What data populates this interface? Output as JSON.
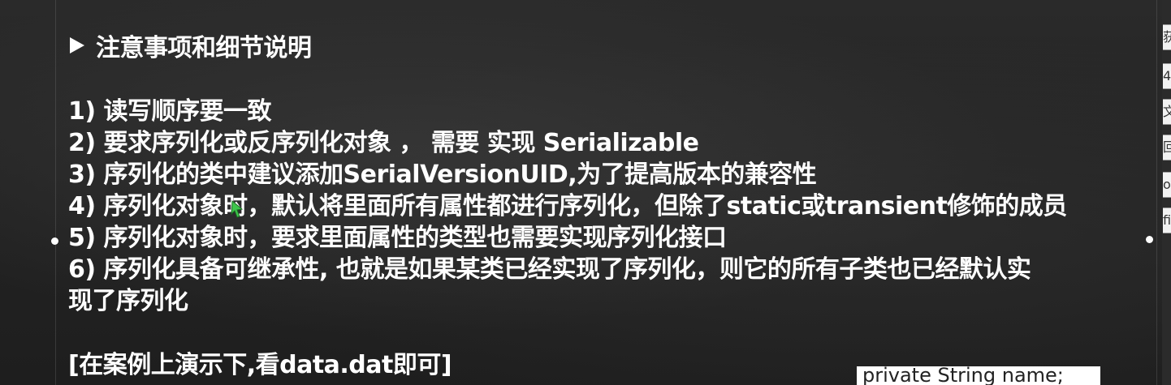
{
  "slide": {
    "heading": "注意事项和细节说明",
    "items": [
      "1) 读写顺序要一致",
      "2) 要求序列化或反序列化对象 ， 需要 实现 Serializable",
      "3) 序列化的类中建议添加SerialVersionUID,为了提高版本的兼容性",
      "4) 序列化对象时，默认将里面所有属性都进行序列化，但除了static或transient修饰的成员",
      "5) 序列化对象时，要求里面属性的类型也需要实现序列化接口",
      "6) 序列化具备可继承性, 也就是如果某类已经实现了序列化，则它的所有子类也已经默认实",
      "现了序列化"
    ],
    "demo_note": "[在案例上演示下,看data.dat即可]"
  },
  "background_code": {
    "text": "private String name;"
  },
  "right_panel": {
    "tabs": [
      "获",
      "4",
      "文",
      "回",
      "o",
      "fi"
    ]
  },
  "colors": {
    "background": "#232323",
    "text": "#ffffff",
    "cursor": "#3ec44b"
  }
}
